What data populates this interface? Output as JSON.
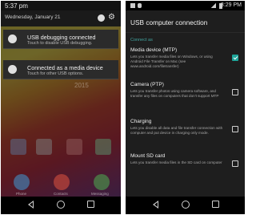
{
  "left_phone": {
    "status_time": "5:37 pm",
    "date": "Wednesday, January 21",
    "notifications": [
      {
        "title": "USB debugging connected",
        "subtitle": "Touch to disable USB debugging."
      },
      {
        "title": "Connected as a media device",
        "subtitle": "Touch for other USB options."
      }
    ],
    "home_apps": [
      {
        "label": "Phone",
        "color": "#3f9ad6"
      },
      {
        "label": "Contacts",
        "color": "#e0533f"
      },
      {
        "label": "Messaging",
        "color": "#4caf50"
      }
    ],
    "watermark": "2015"
  },
  "right_phone": {
    "status_time": "3:29 PM",
    "title": "USB computer connection",
    "section": "Connect as",
    "options": [
      {
        "title": "Media device (MTP)",
        "desc": "Lets you transfer media files on Windows, or using Android File Transfer on Mac (see www.android.com/filetransfer)",
        "checked": true
      },
      {
        "title": "Camera (PTP)",
        "desc": "Lets you transfer photos using camera software, and transfer any files on computers that don't support MTP",
        "checked": false
      },
      {
        "title": "Charging",
        "desc": "Lets you disable all data and file transfer connection with computer and put device in charging only mode.",
        "checked": false
      },
      {
        "title": "Mount SD card",
        "desc": "Lets you transfer media files in the SD card on computer",
        "checked": false
      }
    ]
  },
  "colors": {
    "accent": "#1ea59a",
    "section_header": "#42a5a0"
  }
}
